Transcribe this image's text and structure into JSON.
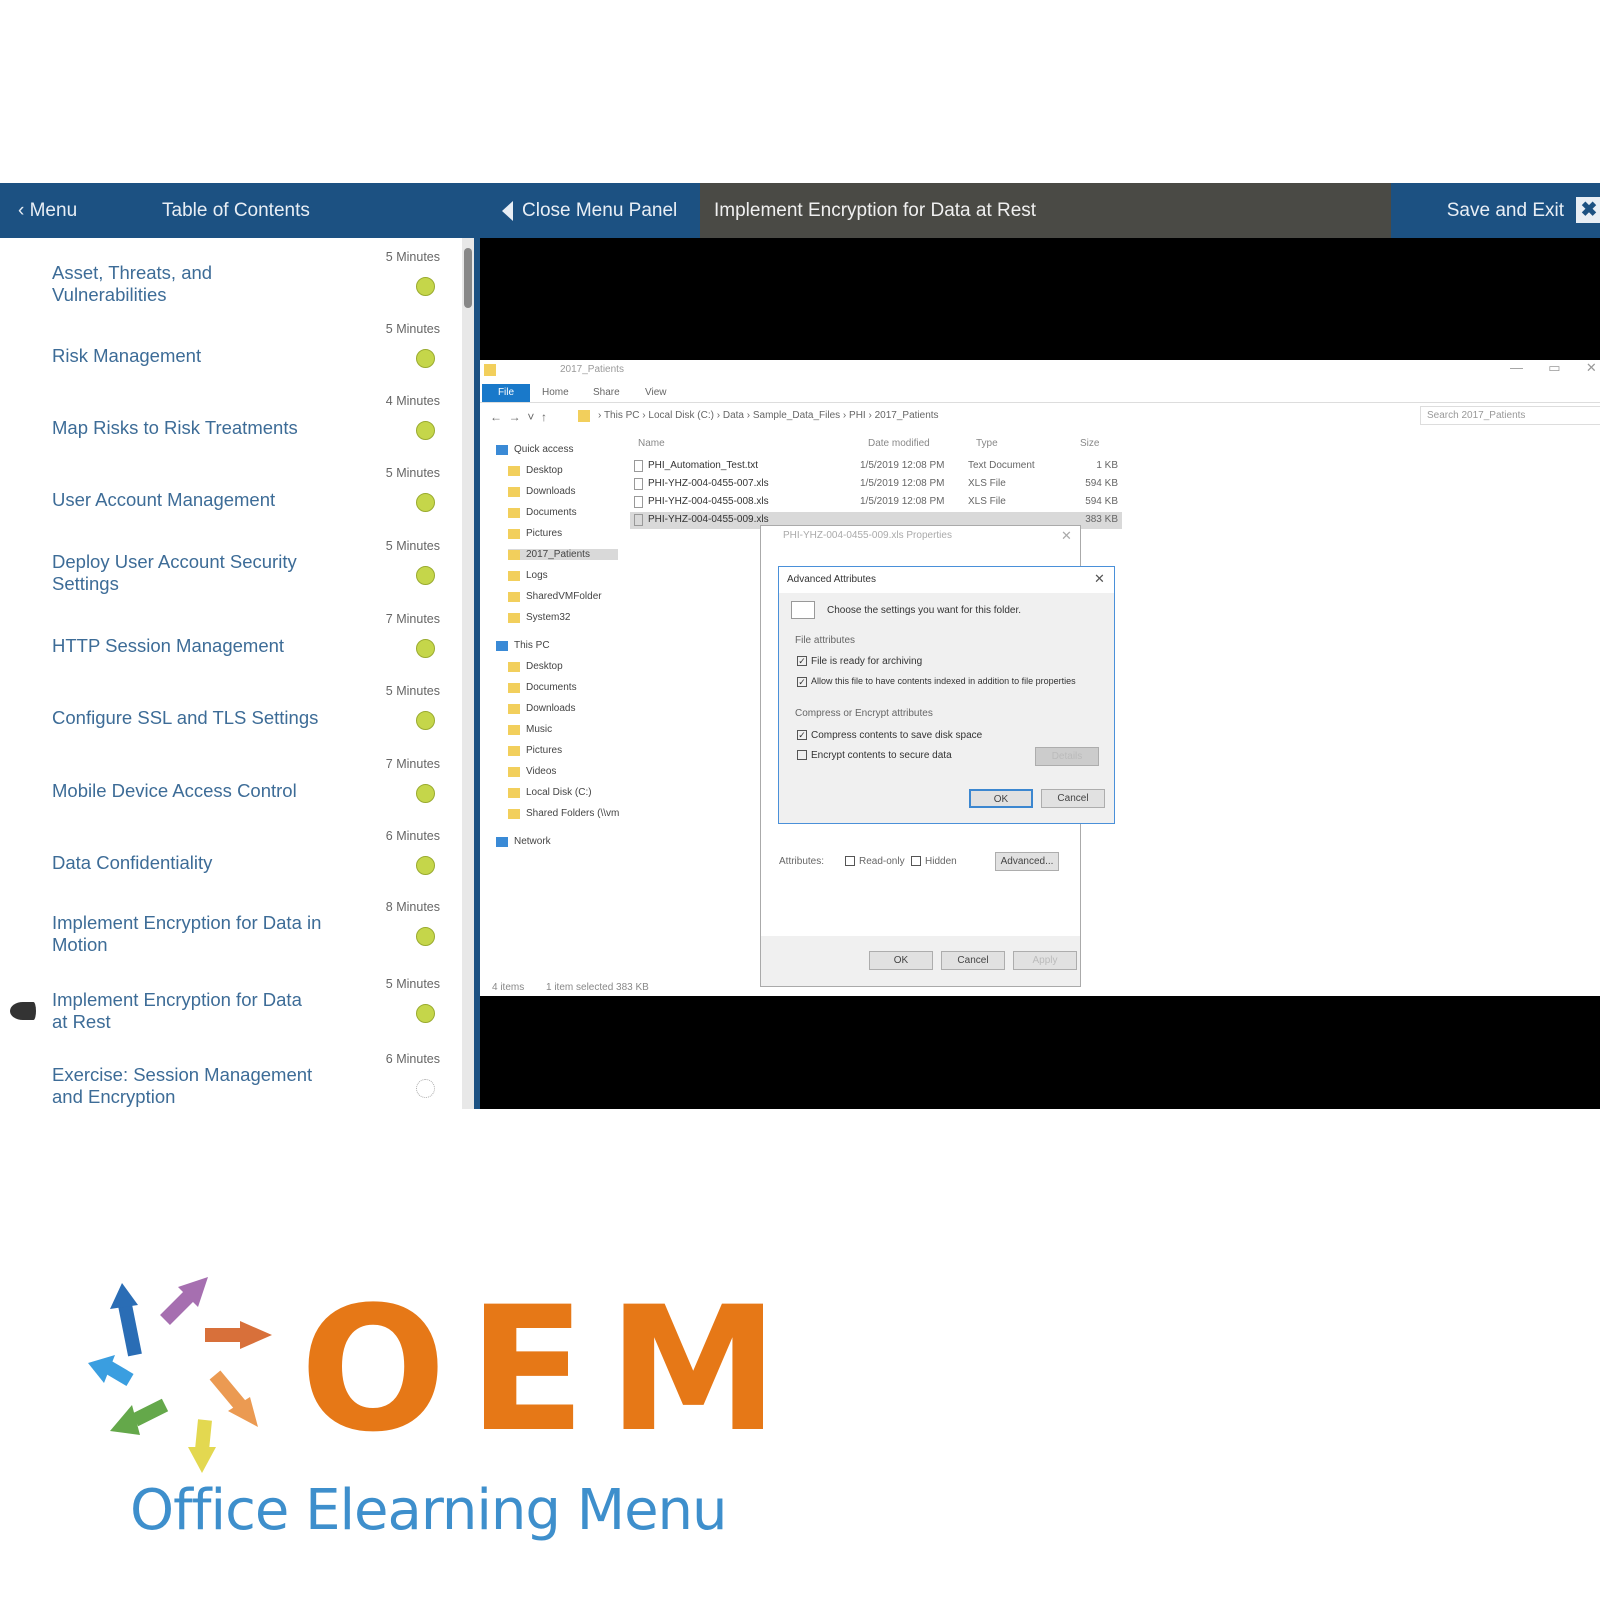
{
  "topbar": {
    "menu_label": "Menu",
    "toc_title": "Table of Contents",
    "close_panel_label": "Close Menu Panel",
    "lesson_title": "Implement Encryption for Data at Rest",
    "save_exit_label": "Save and Exit",
    "close_icon": "✖"
  },
  "toc": {
    "items": [
      {
        "label": "Asset, Threats, and Vulnerabilities",
        "duration": "5 Minutes",
        "status": "complete"
      },
      {
        "label": "Risk Management",
        "duration": "5 Minutes",
        "status": "complete"
      },
      {
        "label": "Map Risks to Risk Treatments",
        "duration": "4 Minutes",
        "status": "complete"
      },
      {
        "label": "User Account Management",
        "duration": "5 Minutes",
        "status": "complete"
      },
      {
        "label": "Deploy User Account Security Settings",
        "duration": "5 Minutes",
        "status": "complete"
      },
      {
        "label": "HTTP Session Management",
        "duration": "7 Minutes",
        "status": "complete"
      },
      {
        "label": "Configure SSL and TLS Settings",
        "duration": "5 Minutes",
        "status": "complete"
      },
      {
        "label": "Mobile Device Access Control",
        "duration": "7 Minutes",
        "status": "complete"
      },
      {
        "label": "Data Confidentiality",
        "duration": "6 Minutes",
        "status": "complete"
      },
      {
        "label": "Implement Encryption for Data in Motion",
        "duration": "8 Minutes",
        "status": "complete"
      },
      {
        "label": "Implement Encryption for Data at Rest",
        "duration": "5 Minutes",
        "status": "complete",
        "current": true
      },
      {
        "label": "Exercise: Session Management and Encryption",
        "duration": "6 Minutes",
        "status": "pending"
      }
    ],
    "complete_color": "#c5d64a"
  },
  "explorer": {
    "window_title": "2017_Patients",
    "ribbon_tabs": [
      "File",
      "Home",
      "Share",
      "View"
    ],
    "breadcrumb": [
      "This PC",
      "Local Disk (C:)",
      "Data",
      "Sample_Data_Files",
      "PHI",
      "2017_Patients"
    ],
    "search_placeholder": "Search 2017_Patients",
    "columns": [
      "Name",
      "Date modified",
      "Type",
      "Size"
    ],
    "files": [
      {
        "name": "PHI_Automation_Test.txt",
        "date": "1/5/2019 12:08 PM",
        "type": "Text Document",
        "size": "1 KB"
      },
      {
        "name": "PHI-YHZ-004-0455-007.xls",
        "date": "1/5/2019 12:08 PM",
        "type": "XLS File",
        "size": "594 KB"
      },
      {
        "name": "PHI-YHZ-004-0455-008.xls",
        "date": "1/5/2019 12:08 PM",
        "type": "XLS File",
        "size": "594 KB"
      },
      {
        "name": "PHI-YHZ-004-0455-009.xls",
        "date": "",
        "type": "",
        "size": "383 KB"
      }
    ],
    "nav": [
      {
        "label": "Quick access",
        "level": 0
      },
      {
        "label": "Desktop",
        "level": 1
      },
      {
        "label": "Downloads",
        "level": 1
      },
      {
        "label": "Documents",
        "level": 1
      },
      {
        "label": "Pictures",
        "level": 1
      },
      {
        "label": "2017_Patients",
        "level": 1,
        "selected": true
      },
      {
        "label": "Logs",
        "level": 1
      },
      {
        "label": "SharedVMFolder",
        "level": 1
      },
      {
        "label": "System32",
        "level": 1
      },
      {
        "label": "This PC",
        "level": 0
      },
      {
        "label": "Desktop",
        "level": 1
      },
      {
        "label": "Documents",
        "level": 1
      },
      {
        "label": "Downloads",
        "level": 1
      },
      {
        "label": "Music",
        "level": 1
      },
      {
        "label": "Pictures",
        "level": 1
      },
      {
        "label": "Videos",
        "level": 1
      },
      {
        "label": "Local Disk (C:)",
        "level": 1
      },
      {
        "label": "Shared Folders (\\\\vm",
        "level": 1
      },
      {
        "label": "Network",
        "level": 0
      }
    ],
    "status_items": "4 items",
    "status_selected": "1 item selected  383 KB"
  },
  "properties_dialog": {
    "title": "PHI-YHZ-004-0455-009.xls Properties",
    "attributes_label": "Attributes:",
    "readonly_label": "Read-only",
    "hidden_label": "Hidden",
    "advanced_button": "Advanced...",
    "ok": "OK",
    "cancel": "Cancel",
    "apply": "Apply"
  },
  "advanced_dialog": {
    "title": "Advanced Attributes",
    "intro": "Choose the settings you want for this folder.",
    "file_attrs_heading": "File attributes",
    "archive_label": "File is ready for archiving",
    "archive_checked": true,
    "index_label": "Allow this file to have contents indexed in addition to file properties",
    "index_checked": true,
    "compress_heading": "Compress or Encrypt attributes",
    "compress_label": "Compress contents to save disk space",
    "compress_checked": true,
    "encrypt_label": "Encrypt contents to secure data",
    "encrypt_checked": false,
    "details_button": "Details",
    "ok": "OK",
    "cancel": "Cancel"
  },
  "logo": {
    "mark": "OEM",
    "tagline": "Office Elearning Menu",
    "mark_color": "#e67817",
    "tagline_color": "#3e8fcc"
  }
}
